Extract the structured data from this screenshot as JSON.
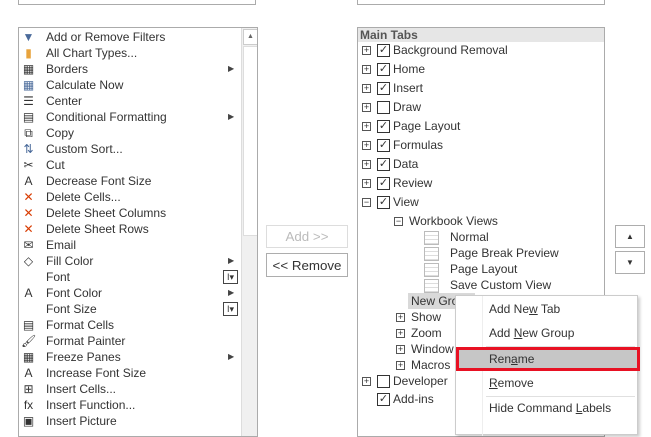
{
  "commands": [
    {
      "label": "Add or Remove Filters",
      "icon": "filter-icon",
      "glyph": "▼"
    },
    {
      "label": "All Chart Types...",
      "icon": "chart-icon",
      "glyph": "▮"
    },
    {
      "label": "Borders",
      "icon": "borders-icon",
      "glyph": "▦",
      "sub": "▶"
    },
    {
      "label": "Calculate Now",
      "icon": "calculator-icon",
      "glyph": "▦"
    },
    {
      "label": "Center",
      "icon": "align-center-icon",
      "glyph": "☰"
    },
    {
      "label": "Conditional Formatting",
      "icon": "conditional-formatting-icon",
      "glyph": "▤",
      "sub": "▶"
    },
    {
      "label": "Copy",
      "icon": "copy-icon",
      "glyph": "⧉"
    },
    {
      "label": "Custom Sort...",
      "icon": "sort-icon",
      "glyph": "⇅"
    },
    {
      "label": "Cut",
      "icon": "scissors-icon",
      "glyph": "✂"
    },
    {
      "label": "Decrease Font Size",
      "icon": "decrease-font-icon",
      "glyph": "A"
    },
    {
      "label": "Delete Cells...",
      "icon": "delete-cells-icon",
      "glyph": "✕"
    },
    {
      "label": "Delete Sheet Columns",
      "icon": "delete-columns-icon",
      "glyph": "✕"
    },
    {
      "label": "Delete Sheet Rows",
      "icon": "delete-rows-icon",
      "glyph": "✕"
    },
    {
      "label": "Email",
      "icon": "email-icon",
      "glyph": "✉"
    },
    {
      "label": "Fill Color",
      "icon": "fill-color-icon",
      "glyph": "◇",
      "sub": "▶"
    },
    {
      "label": "Font",
      "icon": "",
      "glyph": "",
      "box": "I▾"
    },
    {
      "label": "Font Color",
      "icon": "font-color-icon",
      "glyph": "A",
      "sub": "▶"
    },
    {
      "label": "Font Size",
      "icon": "",
      "glyph": "",
      "box": "I▾"
    },
    {
      "label": "Format Cells",
      "icon": "format-cells-icon",
      "glyph": "▤"
    },
    {
      "label": "Format Painter",
      "icon": "paintbrush-icon",
      "glyph": "🖌"
    },
    {
      "label": "Freeze Panes",
      "icon": "freeze-panes-icon",
      "glyph": "▦",
      "sub": "▶"
    },
    {
      "label": "Increase Font Size",
      "icon": "increase-font-icon",
      "glyph": "A"
    },
    {
      "label": "Insert Cells...",
      "icon": "insert-cells-icon",
      "glyph": "⊞"
    },
    {
      "label": "Insert Function...",
      "icon": "function-icon",
      "glyph": "fx"
    },
    {
      "label": "Insert Picture",
      "icon": "picture-icon",
      "glyph": "▣"
    }
  ],
  "middle": {
    "add": "Add >>",
    "remove": "<< Remove",
    "up": "▲",
    "down": "▼"
  },
  "tabs": {
    "header": "Main Tabs",
    "items": [
      {
        "label": "Background Removal",
        "checked": true,
        "expander": "+"
      },
      {
        "label": "Home",
        "checked": true,
        "expander": "+"
      },
      {
        "label": "Insert",
        "checked": true,
        "expander": "+"
      },
      {
        "label": "Draw",
        "checked": false,
        "expander": "+"
      },
      {
        "label": "Page Layout",
        "checked": true,
        "expander": "+"
      },
      {
        "label": "Formulas",
        "checked": true,
        "expander": "+"
      },
      {
        "label": "Data",
        "checked": true,
        "expander": "+"
      },
      {
        "label": "Review",
        "checked": true,
        "expander": "+"
      },
      {
        "label": "View",
        "checked": true,
        "expander": "−"
      }
    ],
    "view_group": {
      "label": "Workbook Views",
      "expander": "−",
      "commands": [
        "Normal",
        "Page Break Preview",
        "Page Layout",
        "Save Custom View"
      ]
    },
    "new_group": "New Group",
    "view_groups": [
      "Show",
      "Zoom",
      "Window",
      "Macros"
    ],
    "developer": "Developer",
    "addins": "Add-ins"
  },
  "context_menu": {
    "items": [
      {
        "pre": "Add Ne",
        "u": "w",
        "post": " Tab"
      },
      {
        "pre": "Add ",
        "u": "N",
        "post": "ew Group"
      },
      {
        "pre": "Ren",
        "u": "a",
        "post": "me"
      },
      {
        "pre": "",
        "u": "R",
        "post": "emove"
      },
      {
        "pre": "Hide Command ",
        "u": "L",
        "post": "abels"
      }
    ],
    "highlight": "#e81123"
  }
}
